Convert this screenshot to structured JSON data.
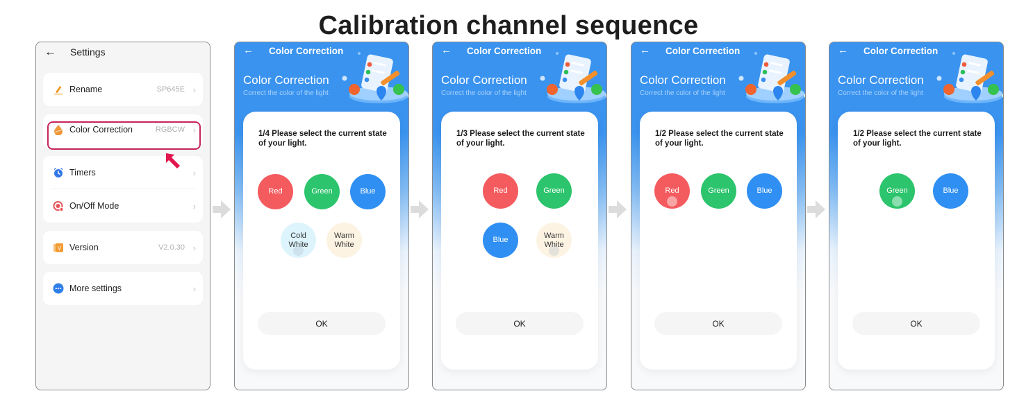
{
  "title": "Calibration channel sequence",
  "settings_screen": {
    "back_icon": "arrow-left-icon",
    "title": "Settings",
    "items": [
      {
        "icon": "pencil-icon",
        "label": "Rename",
        "value": "SP645E",
        "highlighted": false
      },
      {
        "icon": "color-drop-icon",
        "label": "Color Correction",
        "value": "RGBCW",
        "highlighted": true
      },
      {
        "icon": "alarm-clock-icon",
        "label": "Timers",
        "value": "",
        "highlighted": false
      },
      {
        "icon": "power-mode-icon",
        "label": "On/Off Mode",
        "value": "",
        "highlighted": false
      },
      {
        "icon": "version-icon",
        "label": "Version",
        "value": "V2.0.30",
        "highlighted": false
      },
      {
        "icon": "more-dots-icon",
        "label": "More settings",
        "value": "",
        "highlighted": false
      }
    ],
    "chevron": "›",
    "highlight_color": "#c8245a"
  },
  "flow_arrow_icon": "right-arrow-icon",
  "calibration_screens": [
    {
      "header_title": "Color Correction",
      "big_title": "Color Correction",
      "subtitle": "Correct the color of the light",
      "prompt": "1/4  Please select the current state of your light.",
      "options": [
        "Red",
        "Green",
        "Blue",
        "Cold White",
        "Warm White"
      ],
      "touched": "Cold White",
      "ok_label": "OK"
    },
    {
      "header_title": "Color Correction",
      "big_title": "Color Correction",
      "subtitle": "Correct the color of the light",
      "prompt": "1/3  Please select the current state of your light.",
      "options": [
        "Red",
        "Green",
        "Blue",
        "Warm White"
      ],
      "touched": "Warm White",
      "ok_label": "OK"
    },
    {
      "header_title": "Color Correction",
      "big_title": "Color Correction",
      "subtitle": "Correct the color of the light",
      "prompt": "1/2  Please select the current state of your light.",
      "options": [
        "Red",
        "Green",
        "Blue"
      ],
      "touched": "Red",
      "ok_label": "OK"
    },
    {
      "header_title": "Color Correction",
      "big_title": "Color Correction",
      "subtitle": "Correct the color of the light",
      "prompt": "1/2  Please select the current state of your light.",
      "options": [
        "Green",
        "Blue"
      ],
      "touched": "Green",
      "ok_label": "OK"
    }
  ],
  "colors": {
    "Red": "#f45b5e",
    "Green": "#2cc46c",
    "Blue": "#2f8ff2",
    "Cold White": "#ddf4fd",
    "Warm White": "#fdf3e3",
    "header_blue": "#3a93ef"
  }
}
